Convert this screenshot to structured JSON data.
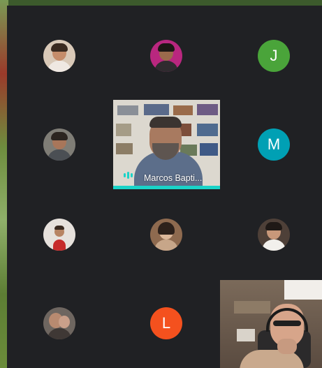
{
  "participants": [
    {
      "id": "p1",
      "kind": "photo"
    },
    {
      "id": "p2",
      "kind": "photo"
    },
    {
      "id": "p3",
      "kind": "letter",
      "letter": "J",
      "color": "#4aa43a"
    },
    {
      "id": "p4",
      "kind": "photo"
    },
    {
      "id": "p5",
      "kind": "letter",
      "letter": "M",
      "color": "#00a0b4"
    },
    {
      "id": "p6",
      "kind": "photo"
    },
    {
      "id": "p7",
      "kind": "photo"
    },
    {
      "id": "p8",
      "kind": "photo"
    },
    {
      "id": "p9",
      "kind": "photo"
    },
    {
      "id": "p10",
      "kind": "letter",
      "letter": "L",
      "color": "#f4511e"
    }
  ],
  "spotlight": {
    "name": "Marcos Bapti..."
  },
  "colors": {
    "stage": "#202124",
    "speaking_accent": "#1ad3c8"
  },
  "icons": {
    "speaking": "audio-level-icon"
  }
}
